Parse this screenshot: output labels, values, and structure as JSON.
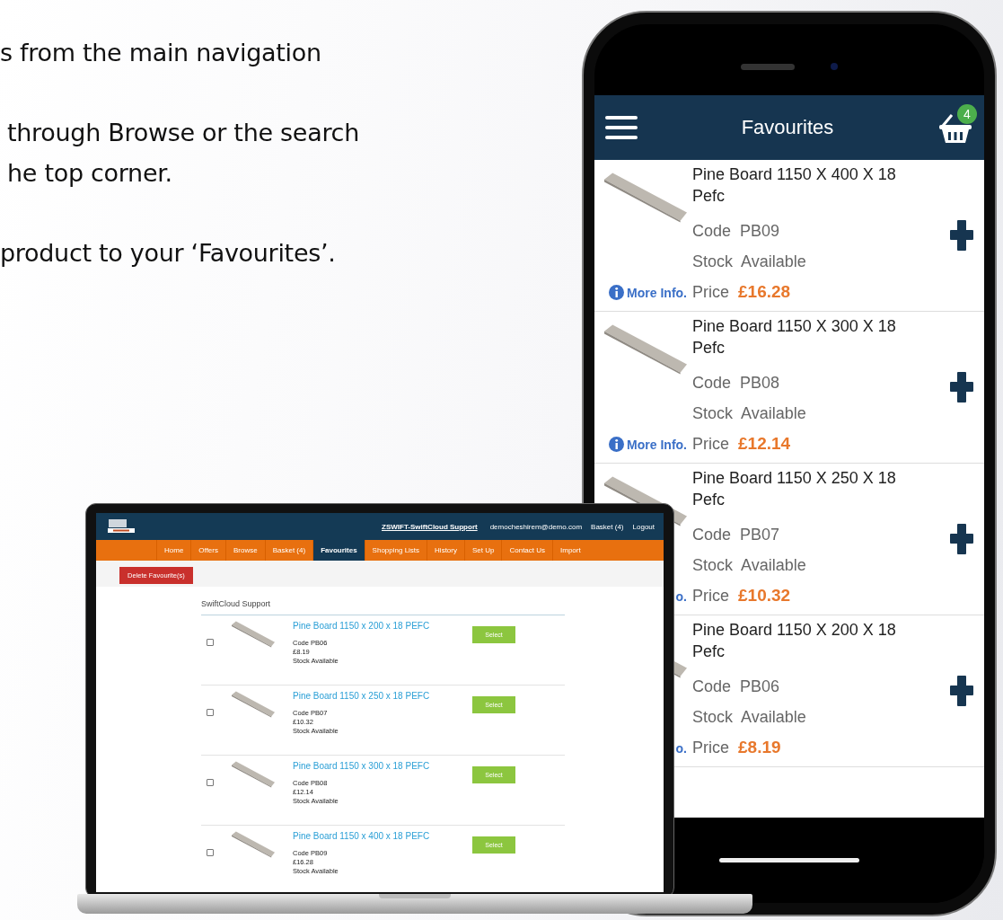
{
  "instructions": [
    {
      "lines": [
        "s from the main navigation"
      ]
    },
    {
      "lines": [
        "through Browse or the search",
        "he top corner."
      ]
    },
    {
      "lines": [
        "product to your ‘Favourites’."
      ]
    }
  ],
  "phone": {
    "title": "Favourites",
    "basket_count": "4",
    "products": [
      {
        "title": "Pine Board 1150 X 400 X 18 Pefc",
        "code_label": "Code",
        "code": "PB09",
        "stock_label": "Stock",
        "stock": "Available",
        "price_label": "Price",
        "price": "£16.28",
        "more_info": "More Info.",
        "info_icon": true
      },
      {
        "title": "Pine Board 1150 X 300 X 18 Pefc",
        "code_label": "Code",
        "code": "PB08",
        "stock_label": "Stock",
        "stock": "Available",
        "price_label": "Price",
        "price": "£12.14",
        "more_info": "More Info.",
        "info_icon": true
      },
      {
        "title": "Pine Board 1150 X 250 X 18 Pefc",
        "code_label": "Code",
        "code": "PB07",
        "stock_label": "Stock",
        "stock": "Available",
        "price_label": "Price",
        "price": "£10.32",
        "more_info": "o.",
        "info_icon": false
      },
      {
        "title": "Pine Board 1150 X 200 X 18 Pefc",
        "code_label": "Code",
        "code": "PB06",
        "stock_label": "Stock",
        "stock": "Available",
        "price_label": "Price",
        "price": "£8.19",
        "more_info": "o.",
        "info_icon": false
      }
    ]
  },
  "laptop": {
    "account": "ZSWIFT-SwiftCloud Support",
    "header_links": [
      "democheshirem@demo.com",
      "Basket (4)",
      "Logout"
    ],
    "nav": [
      {
        "label": "Home",
        "selected": false
      },
      {
        "label": "Offers",
        "selected": false
      },
      {
        "label": "Browse",
        "selected": false
      },
      {
        "label": "Basket (4)",
        "selected": false
      },
      {
        "label": "Favourites",
        "selected": true
      },
      {
        "label": "Shopping Lists",
        "selected": false
      },
      {
        "label": "History",
        "selected": false
      },
      {
        "label": "Set Up",
        "selected": false
      },
      {
        "label": "Contact Us",
        "selected": false
      },
      {
        "label": "Import",
        "selected": false
      }
    ],
    "delete_button": "Delete Favourite(s)",
    "section_title": "SwiftCloud Support",
    "products": [
      {
        "title": "Pine Board 1150 x 200 x 18 PEFC",
        "code": "Code PB06",
        "price": "£8.19",
        "stock": "Stock Available",
        "checked": false,
        "button": "Select"
      },
      {
        "title": "Pine Board 1150 x 250 x 18 PEFC",
        "code": "Code PB07",
        "price": "£10.32",
        "stock": "Stock Available",
        "checked": false,
        "button": "Select"
      },
      {
        "title": "Pine Board 1150 x 300 x 18 PEFC",
        "code": "Code PB08",
        "price": "£12.14",
        "stock": "Stock Available",
        "checked": false,
        "button": "Select"
      },
      {
        "title": "Pine Board 1150 x 400 x 18 PEFC",
        "code": "Code PB09",
        "price": "£16.28",
        "stock": "Stock Available",
        "checked": false,
        "button": "Select"
      }
    ]
  }
}
